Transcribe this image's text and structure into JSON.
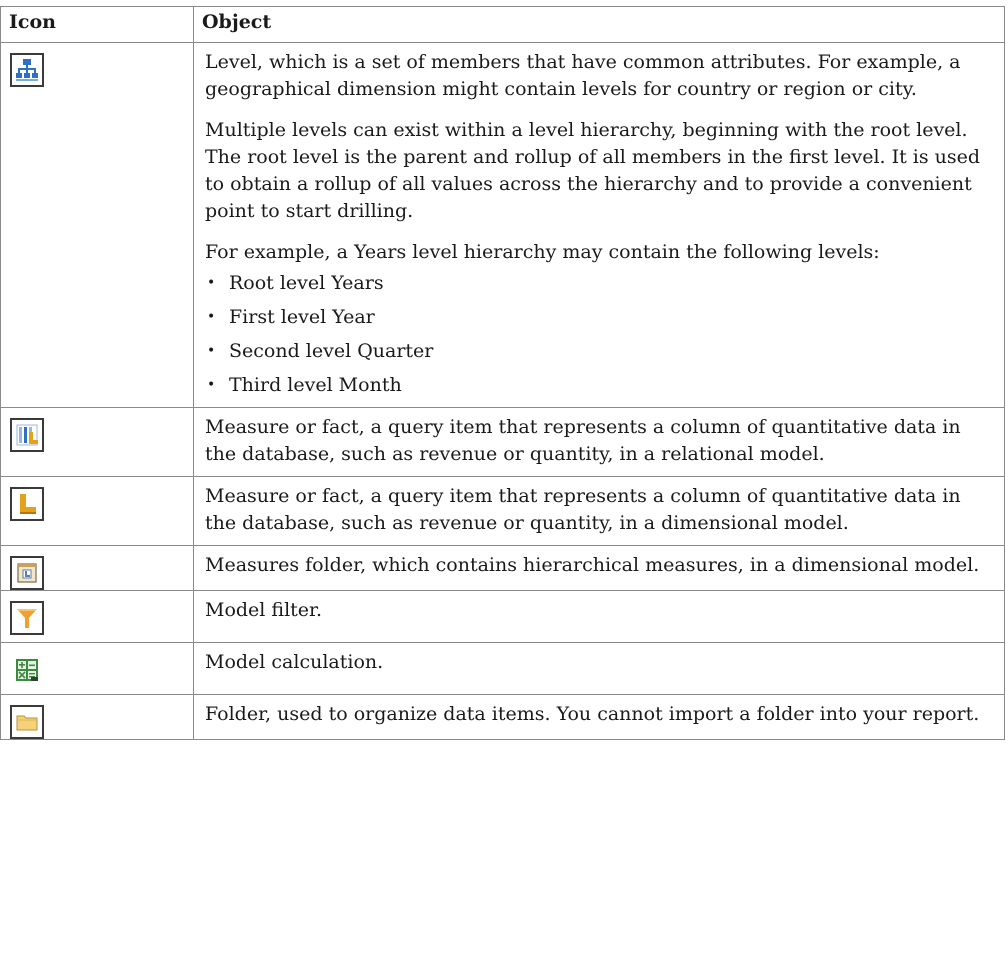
{
  "table": {
    "headers": {
      "icon": "Icon",
      "object": "Object"
    },
    "rows": [
      {
        "icon": "level-hierarchy-icon",
        "paragraphs": [
          "Level, which is a set of members that have common attributes. For example, a geographical dimension might contain levels for country or region or city.",
          "Multiple levels can exist within a level hierarchy, beginning with the root level. The root level is the parent and rollup of all members in the first level. It is used to obtain a rollup of all values across the hierarchy and to provide a convenient point to start drilling.",
          "For example, a Years level hierarchy may contain the following levels:"
        ],
        "bullets": [
          "Root level Years",
          "First level Year",
          "Second level Quarter",
          "Third level Month"
        ]
      },
      {
        "icon": "relational-measure-icon",
        "text": "Measure or fact, a query item that represents a column of quantitative data in the database, such as revenue or quantity, in a relational model."
      },
      {
        "icon": "dimensional-measure-icon",
        "text": "Measure or fact, a query item that represents a column of quantitative data in the database, such as revenue or quantity, in a dimensional model."
      },
      {
        "icon": "measures-folder-icon",
        "text": "Measures folder, which contains hierarchical measures, in a dimensional model."
      },
      {
        "icon": "filter-funnel-icon",
        "text": "Model filter."
      },
      {
        "icon": "calculation-icon",
        "text": "Model calculation."
      },
      {
        "icon": "folder-icon",
        "text": "Folder, used to organize data items. You cannot import a folder into your report."
      }
    ]
  },
  "colors": {
    "border": "#8a8a8a",
    "level_icon_blue": "#2f6fc4",
    "measure_orange": "#e3a21a",
    "filter_orange": "#f0a030",
    "calc_green": "#3d8a3d",
    "folder_yellow": "#f5d27a"
  }
}
